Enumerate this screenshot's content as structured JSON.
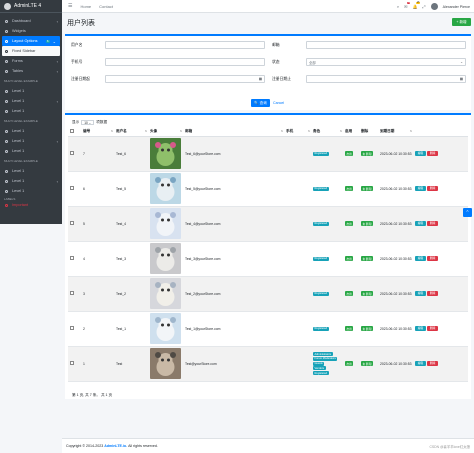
{
  "brand": {
    "name": "AdminLTE 4"
  },
  "navbar": {
    "home": "Home",
    "contact": "Contact",
    "msg_badge": "3",
    "notif_badge": "15",
    "user_name": "Alexander Pierce"
  },
  "sidebar": {
    "items": [
      {
        "label": "Dashboard"
      },
      {
        "label": "Widgets"
      },
      {
        "label": "Layout Options",
        "badge": "6"
      },
      {
        "label": "Fixed Sidebar"
      },
      {
        "label": "Forms"
      },
      {
        "label": "Tables"
      }
    ],
    "header1": "MULTI LEVEL EXAMPLE",
    "level_a": [
      "Level 1",
      "Level 1",
      "Level 1"
    ],
    "header2": "MULTI LEVEL EXAMPLE",
    "level_b": [
      "Level 1",
      "Level 1",
      "Level 1"
    ],
    "header3": "MULTI LEVEL EXAMPLE",
    "level_c": [
      "Level 1",
      "Level 1",
      "Level 1"
    ],
    "header4": "LABELS",
    "important": "Important"
  },
  "page": {
    "title": "用户列表",
    "add_label": "+ 新增"
  },
  "search": {
    "username_label": "用户名",
    "email_label": "邮箱",
    "phone_label": "手机号",
    "status_label": "状态",
    "status_value": "全部",
    "date_label": "注册日期起",
    "date_end_label": "注册日期止",
    "search_label": "🔍 查询",
    "cancel_label": "Cancel"
  },
  "table": {
    "show_label": "显示",
    "per_page": "10",
    "records_label": "项数据",
    "headers": [
      "编号",
      "用户名",
      "头像",
      "邮箱",
      "手机",
      "角色",
      "启用",
      "删除",
      "到期日期"
    ],
    "rows": [
      {
        "id": "7",
        "username": "Test_6",
        "email": "Test_6@yourStore.com",
        "roles": [
          "Registered"
        ],
        "enable": "启用",
        "delete": "未 删 除",
        "date": "2023-06-02 10:30:53",
        "edit": "编辑",
        "del": "删除"
      },
      {
        "id": "6",
        "username": "Test_5",
        "email": "Test_5@yourStore.com",
        "roles": [
          "Registered"
        ],
        "enable": "启用",
        "delete": "未 删 除",
        "date": "2023-06-02 10:30:53",
        "edit": "编辑",
        "del": "删除"
      },
      {
        "id": "5",
        "username": "Test_4",
        "email": "Test_4@yourStore.com",
        "roles": [
          "Registered"
        ],
        "enable": "启用",
        "delete": "未 删 除",
        "date": "2023-06-02 10:30:53",
        "edit": "编辑",
        "del": "删除"
      },
      {
        "id": "4",
        "username": "Test_3",
        "email": "Test_3@yourStore.com",
        "roles": [
          "Registered"
        ],
        "enable": "启用",
        "delete": "未 删 除",
        "date": "2023-06-02 10:30:53",
        "edit": "编辑",
        "del": "删除"
      },
      {
        "id": "3",
        "username": "Test_2",
        "email": "Test_2@yourStore.com",
        "roles": [
          "Registered"
        ],
        "enable": "启用",
        "delete": "未 删 除",
        "date": "2023-06-02 10:30:53",
        "edit": "编辑",
        "del": "删除"
      },
      {
        "id": "2",
        "username": "Test_1",
        "email": "Test_1@yourStore.com",
        "roles": [
          "Registered"
        ],
        "enable": "启用",
        "delete": "未 删 除",
        "date": "2023-06-02 10:30:53",
        "edit": "编辑",
        "del": "删除"
      },
      {
        "id": "1",
        "username": "Test",
        "email": "Test@yourStore.com",
        "roles": [
          "Administrators",
          "Forum Moderators",
          "Guests",
          "Vendors",
          "Registered"
        ],
        "enable": "启用",
        "delete": "未 删 除",
        "date": "2023-06-02 10:30:53",
        "edit": "编辑",
        "del": "删除"
      }
    ],
    "footer": "第 1 页, 共 7 条。 共 1 页"
  },
  "footer": {
    "prefix": "Copyright © 2014-2023",
    "brand": "AdminLTE.io.",
    "suffix": "All rights reserved.",
    "watermark": "CSDN @喜羊羊love红太狼"
  },
  "colors": {
    "primary": "#007bff",
    "success": "#28a745",
    "info": "#17a2b8",
    "danger": "#dc3545",
    "sidebar": "#343a40"
  }
}
